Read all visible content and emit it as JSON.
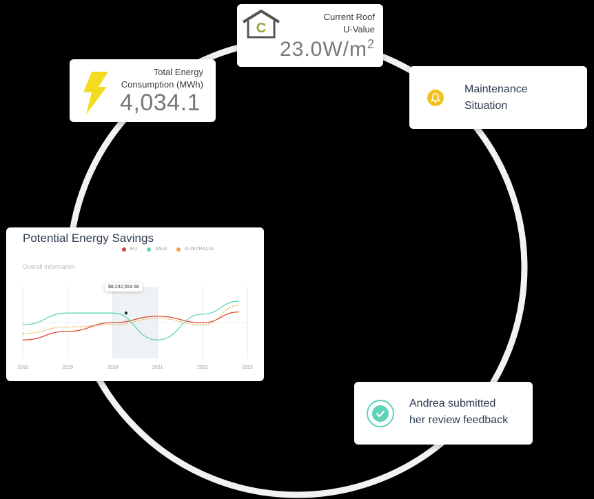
{
  "energy_card": {
    "label_line1": "Total Energy",
    "label_line2": "Consumption (MWh)",
    "value": "4,034.1",
    "icon": "lightning-bolt-icon",
    "icon_color": "#f3dc20"
  },
  "roof_card": {
    "label_line1": "Current Roof",
    "label_line2": "U-Value",
    "value": "23.0W/m",
    "value_sup": "2",
    "icon": "house-c-icon",
    "badge_letter": "C",
    "badge_color": "#8fa83a"
  },
  "maintenance_card": {
    "label_line1": "Maintenance",
    "label_line2": "Situation",
    "icon": "bell-icon",
    "icon_color": "#f3c11c"
  },
  "feedback_card": {
    "label_line1": "Andrea submitted",
    "label_line2": "her review feedback",
    "icon": "check-circle-icon",
    "icon_color": "#5fd3b8"
  },
  "chart_card": {
    "title": "Potential Energy Savings",
    "subtitle": "Overall Information",
    "tooltip": "$8,242,554.58"
  },
  "chart_data": {
    "type": "line",
    "x": [
      2018,
      2019,
      2020,
      2021,
      2022,
      2023
    ],
    "xticks": [
      "2018",
      "2019",
      "2020",
      "2021",
      "2022",
      "2023"
    ],
    "series": [
      {
        "name": "EU",
        "color": "#d9472b",
        "values": [
          30,
          38,
          46,
          52,
          46,
          56
        ]
      },
      {
        "name": "ASIA",
        "color": "#5fd3b8",
        "values": [
          44,
          55,
          55,
          30,
          54,
          66
        ]
      },
      {
        "name": "AUSTRALIA",
        "color": "#f0a43c",
        "values": [
          36,
          42,
          44,
          50,
          44,
          62
        ],
        "dashed": true
      }
    ],
    "ylim": [
      0,
      100
    ],
    "grid": true,
    "legend": "top-center",
    "highlight_x": 2020.3
  }
}
